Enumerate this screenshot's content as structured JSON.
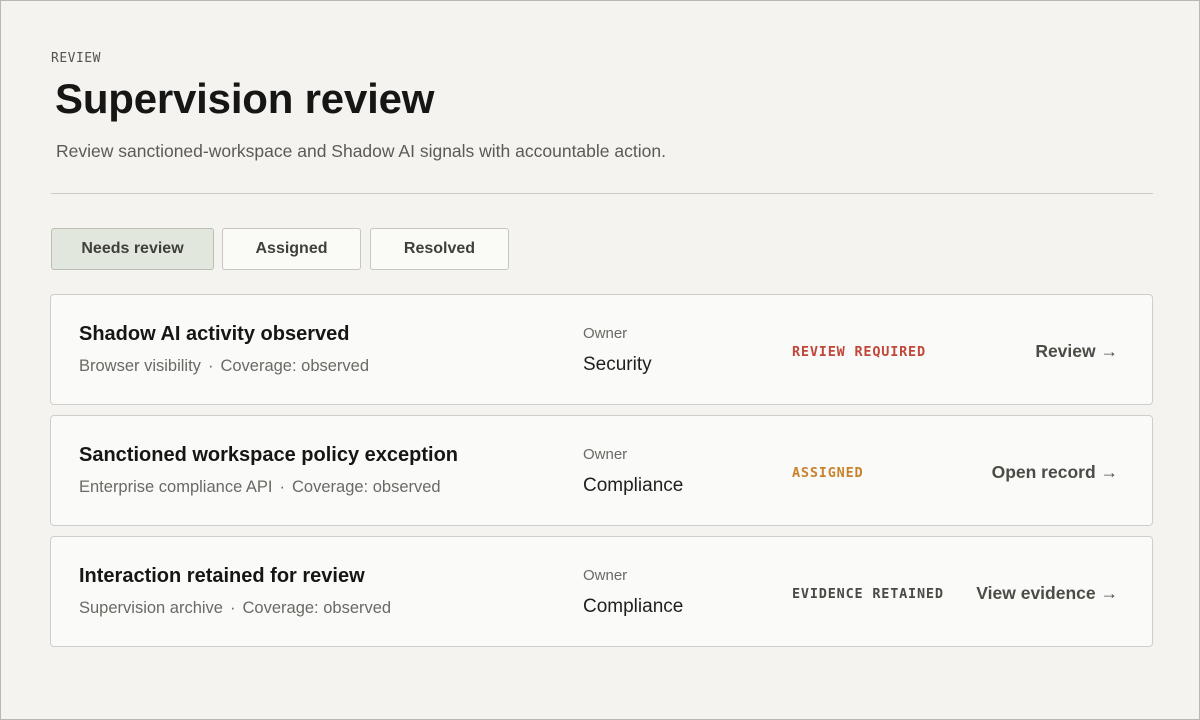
{
  "header": {
    "eyebrow": "REVIEW",
    "title": "Supervision review",
    "subtitle": "Review sanctioned-workspace and Shadow AI signals with accountable action."
  },
  "tabs": [
    {
      "label": "Needs review",
      "active": true
    },
    {
      "label": "Assigned",
      "active": false
    },
    {
      "label": "Resolved",
      "active": false
    }
  ],
  "owner_label": "Owner",
  "separator": "·",
  "items": [
    {
      "title": "Shadow AI activity observed",
      "source": "Browser visibility",
      "coverage": "Coverage: observed",
      "owner": "Security",
      "status": "REVIEW REQUIRED",
      "status_color": "#c0473a",
      "action": "Review →"
    },
    {
      "title": "Sanctioned workspace policy exception",
      "source": "Enterprise compliance API",
      "coverage": "Coverage: observed",
      "owner": "Compliance",
      "status": "ASSIGNED",
      "status_color": "#c9822c",
      "action": "Open record →"
    },
    {
      "title": "Interaction retained for review",
      "source": "Supervision archive",
      "coverage": "Coverage: observed",
      "owner": "Compliance",
      "status": "EVIDENCE RETAINED",
      "status_color": "#4a4a45",
      "action": "View evidence →"
    }
  ]
}
